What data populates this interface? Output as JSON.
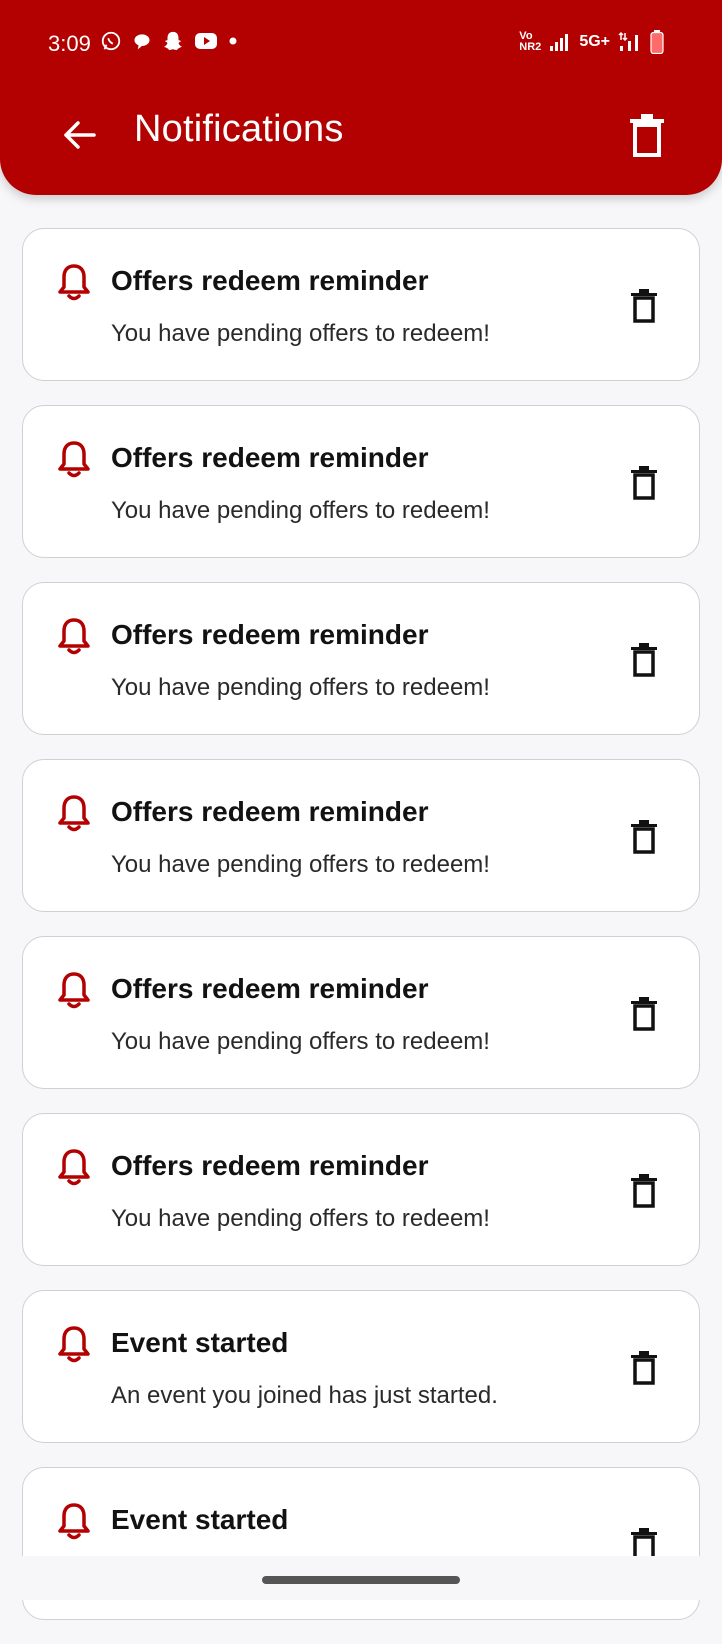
{
  "status_bar": {
    "time": "3:09",
    "left_icons": [
      "whatsapp-icon",
      "chat-icon",
      "snapchat-icon",
      "youtube-icon",
      "dot-icon"
    ],
    "volte_top": "Vo",
    "volte_bottom": "NR2",
    "network": "5G+"
  },
  "header": {
    "title": "Notifications",
    "back_icon": "arrow-left-icon",
    "delete_all_icon": "trash-icon",
    "bg_color": "#b30000"
  },
  "notifications": [
    {
      "title": "Offers redeem reminder",
      "body": "You have pending offers to redeem!"
    },
    {
      "title": "Offers redeem reminder",
      "body": "You have pending offers to redeem!"
    },
    {
      "title": "Offers redeem reminder",
      "body": "You have pending offers to redeem!"
    },
    {
      "title": "Offers redeem reminder",
      "body": "You have pending offers to redeem!"
    },
    {
      "title": "Offers redeem reminder",
      "body": "You have pending offers to redeem!"
    },
    {
      "title": "Offers redeem reminder",
      "body": "You have pending offers to redeem!"
    },
    {
      "title": "Event started",
      "body": "An event you joined has just started."
    },
    {
      "title": "Event started",
      "body": ""
    }
  ],
  "colors": {
    "accent": "#b30000",
    "bell": "#b30000"
  }
}
